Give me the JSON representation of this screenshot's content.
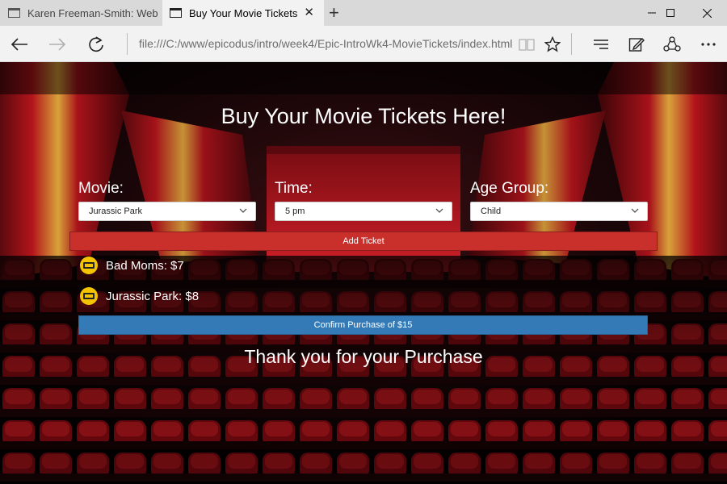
{
  "browser": {
    "tabs": [
      {
        "label": "Karen Freeman-Smith: Web",
        "active": false
      },
      {
        "label": "Buy Your Movie Tickets",
        "active": true
      }
    ],
    "tab_close_symbol": "✕",
    "new_tab_symbol": "+",
    "url": "file:///C:/www/epicodus/intro/week4/Epic-IntroWk4-MovieTickets/index.html"
  },
  "page": {
    "title": "Buy Your Movie Tickets Here!",
    "movie": {
      "label": "Movie:",
      "value": "Jurassic Park"
    },
    "time": {
      "label": "Time:",
      "value": "5 pm"
    },
    "age": {
      "label": "Age Group:",
      "value": "Child"
    },
    "add_button": "Add Ticket",
    "tickets": [
      {
        "text": "Bad Moms: $7"
      },
      {
        "text": "Jurassic Park: $8"
      }
    ],
    "confirm_button": "Confirm Purchase of $15",
    "thanks": "Thank you for your Purchase"
  },
  "colors": {
    "add_button": "#c9302c",
    "confirm_button": "#337ab7",
    "ticket_icon": "#f5c400"
  },
  "icons": [
    "tab-page-icon",
    "close-icon",
    "plus-icon",
    "minimize-icon",
    "maximize-icon",
    "window-close-icon",
    "back-arrow-icon",
    "forward-arrow-icon",
    "refresh-icon",
    "reading-view-icon",
    "star-icon",
    "hub-icon",
    "web-note-icon",
    "share-icon",
    "more-icon",
    "chevron-down-icon",
    "ticket-icon"
  ]
}
